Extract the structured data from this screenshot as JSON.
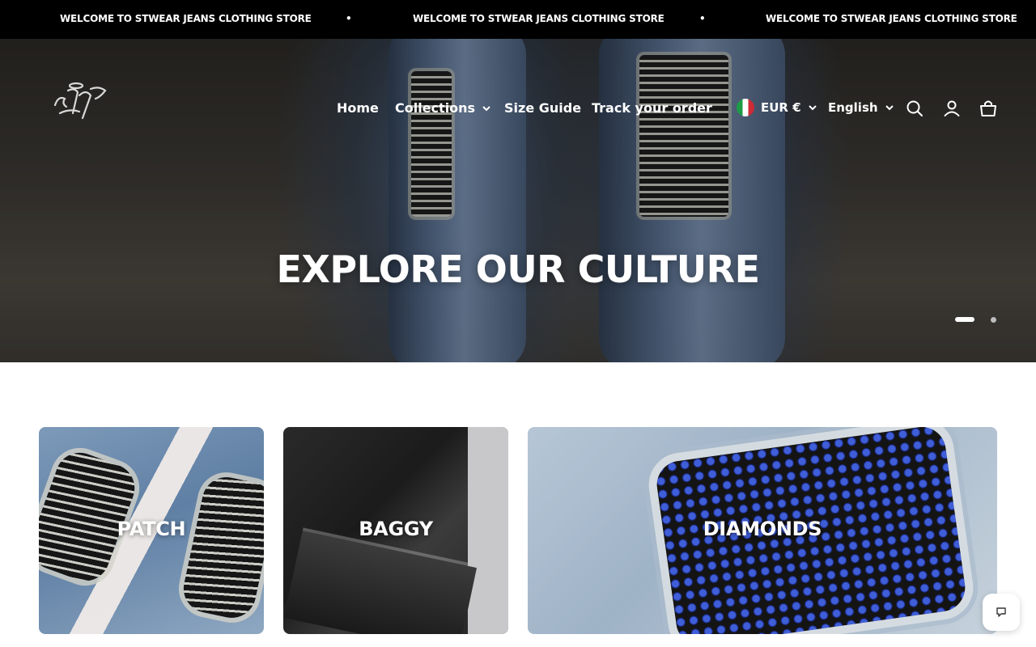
{
  "announcement": {
    "messages": [
      "WELCOME TO STWEAR JEANS CLOTHING STORE",
      "WELCOME TO STWEAR JEANS CLOTHING STORE",
      "WELCOME TO STWEAR JEANS CLOTHING STORE"
    ],
    "separator": "•"
  },
  "header": {
    "nav": {
      "home": "Home",
      "collections": "Collections",
      "size_guide": "Size Guide",
      "track_order": "Track your order"
    },
    "currency": "EUR €",
    "language": "English",
    "icons": [
      "search-icon",
      "account-icon",
      "cart-icon"
    ]
  },
  "hero": {
    "title": "EXPLORE OUR CULTURE",
    "slides_total": 2,
    "active_slide": 1
  },
  "collections": [
    {
      "label": "PATCH"
    },
    {
      "label": "BAGGY"
    },
    {
      "label": "DIAMONDS"
    }
  ],
  "chat": {
    "icon": "chat-icon"
  },
  "colors": {
    "announcement_bg": "#000000",
    "text_on_dark": "#ffffff",
    "page_bg": "#ffffff"
  }
}
